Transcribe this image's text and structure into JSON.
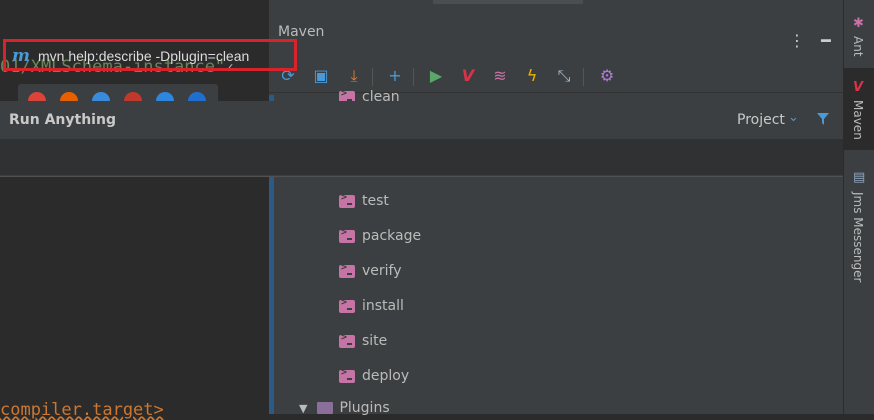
{
  "editor": {
    "code_line_1": "01/XMLSchema-instance\"",
    "code_line_1_mark": "✓",
    "code_line_2": "compiler.target>"
  },
  "maven": {
    "title": "Maven",
    "more_icon": "more-vertical-icon",
    "minimize_icon": "minimize-icon",
    "toolbar": [
      "reload-icon",
      "reimport-folder-icon",
      "download-sources-icon",
      "add-icon",
      "run-icon",
      "execute-maven-goal-icon",
      "toggle-offline-icon",
      "skip-tests-icon",
      "collapse-all-icon",
      "settings-icon"
    ],
    "lifecycle": [
      "clean",
      "test",
      "package",
      "verify",
      "install",
      "site",
      "deploy"
    ],
    "plugins_label": "Plugins"
  },
  "run_anything": {
    "title": "Run Anything",
    "scope": "Project",
    "input_value": "mvn help:describe -Dplugin=clean",
    "prefix_icon": "maven-m-icon"
  },
  "right_stripe": {
    "tabs": [
      "Ant",
      "Maven",
      "Jms Messenger"
    ]
  },
  "colors": {
    "accent": "#4a9ad8",
    "highlight_border": "#d9232a",
    "goal_icon": "#c673a5",
    "run_green": "#59a869"
  }
}
